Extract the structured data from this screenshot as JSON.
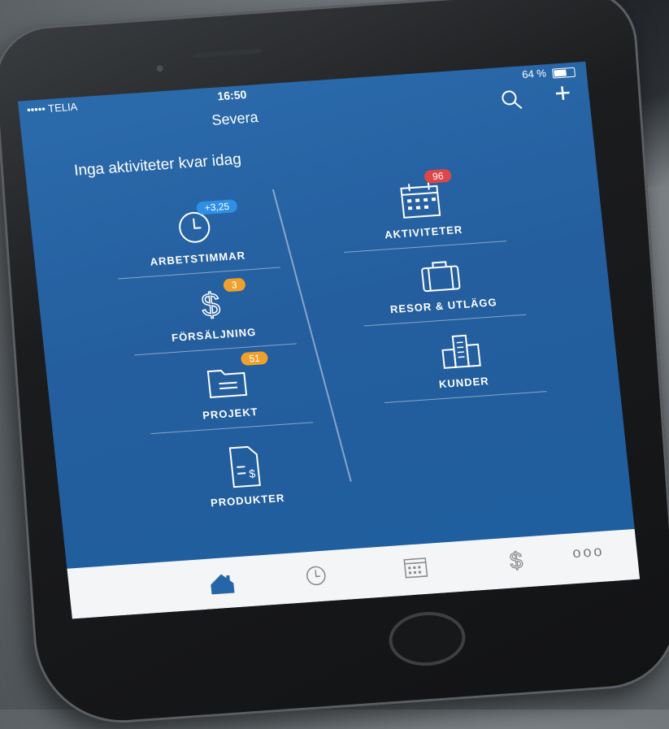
{
  "status": {
    "carrier": "••••• TELIA",
    "time": "16:50",
    "battery": "64 %"
  },
  "nav": {
    "title": "Severa"
  },
  "headline": "Inga aktiviteter kvar idag",
  "tiles": {
    "arbetstimmar": {
      "label": "ARBETSTIMMAR",
      "badge": "+3,25"
    },
    "forsaljning": {
      "label": "FÖRSÄLJNING",
      "badge": "3"
    },
    "projekt": {
      "label": "PROJEKT",
      "badge": "51"
    },
    "produkter": {
      "label": "PRODUKTER"
    },
    "aktiviteter": {
      "label": "AKTIVITETER",
      "badge": "96"
    },
    "resor": {
      "label": "RESOR & UTLÄGG"
    },
    "kunder": {
      "label": "KUNDER"
    }
  },
  "tabbar": {
    "more": "ooo"
  },
  "colors": {
    "primary": "#2566a8",
    "badge_blue": "#2f8fe6",
    "badge_orange": "#f0a12b",
    "badge_red": "#e04646",
    "home_tab": "#2566a8"
  },
  "icons": {
    "clock": "clock-icon",
    "dollar": "dollar-icon",
    "folder": "folder-icon",
    "document": "document-icon",
    "calendar": "calendar-icon",
    "briefcase": "briefcase-icon",
    "buildings": "buildings-icon",
    "home": "home-icon",
    "search": "search-icon",
    "plus": "plus-icon"
  }
}
